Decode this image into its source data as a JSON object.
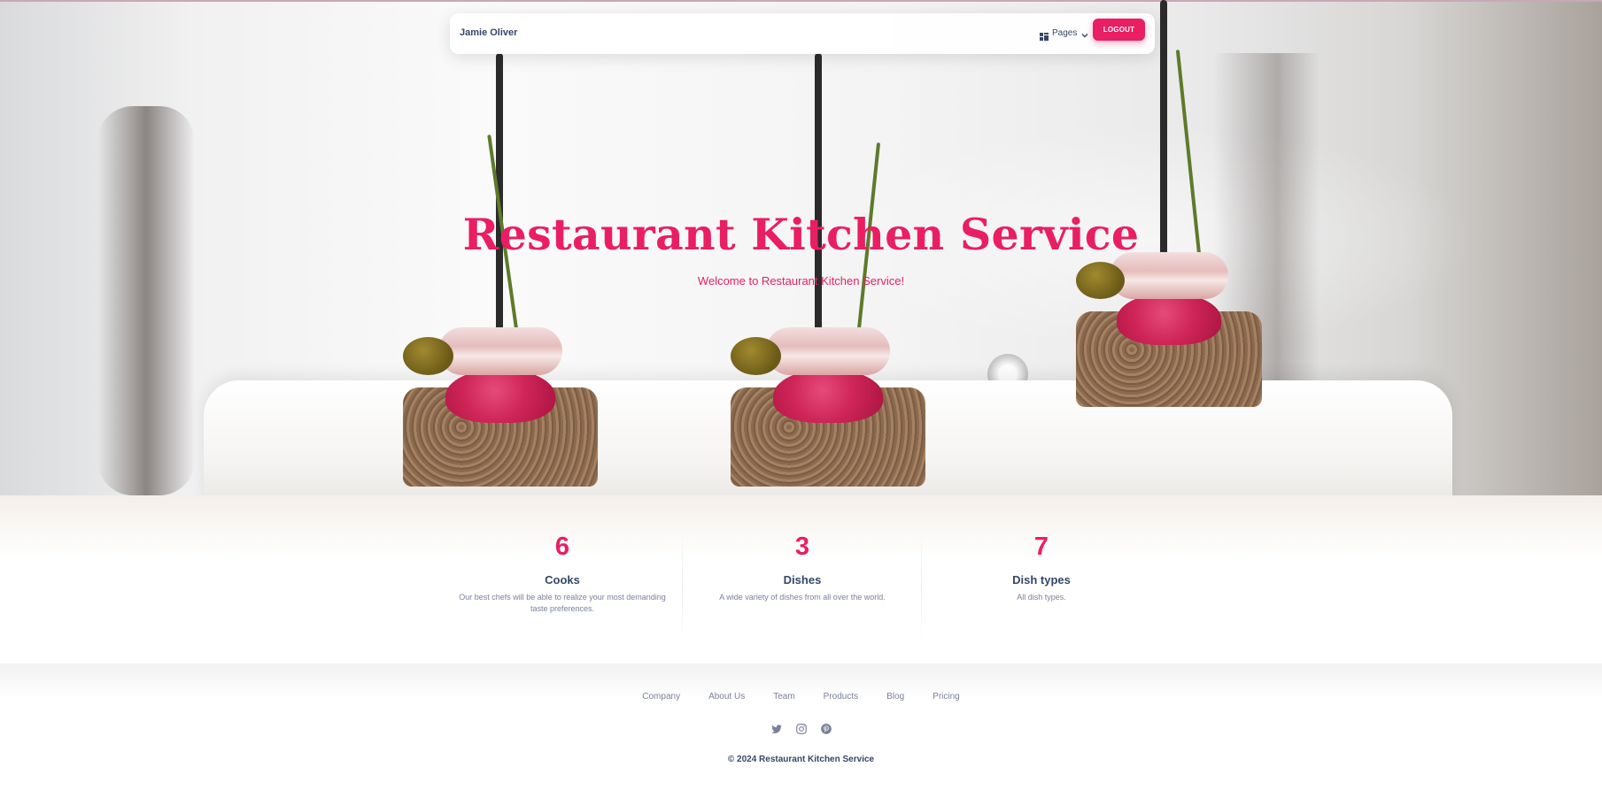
{
  "navbar": {
    "brand": "Jamie Oliver",
    "pages_label": "Pages",
    "logout_label": "LOGOUT"
  },
  "hero": {
    "title": "Restaurant Kitchen Service",
    "subtitle": "Welcome to Restaurant Kitchen Service!"
  },
  "stats": [
    {
      "number": "6",
      "title": "Cooks",
      "description": "Our best chefs will be able to realize your most demanding taste preferences."
    },
    {
      "number": "3",
      "title": "Dishes",
      "description": "A wide variety of dishes from all over the world."
    },
    {
      "number": "7",
      "title": "Dish types",
      "description": "All dish types."
    }
  ],
  "footer": {
    "links": [
      "Company",
      "About Us",
      "Team",
      "Products",
      "Blog",
      "Pricing"
    ],
    "social_icons": [
      "twitter-icon",
      "instagram-icon",
      "pinterest-icon"
    ],
    "copyright": "© 2024 Restaurant Kitchen Service"
  },
  "colors": {
    "accent": "#e91e63",
    "text_dark": "#344767",
    "text_muted": "#7b809a"
  }
}
